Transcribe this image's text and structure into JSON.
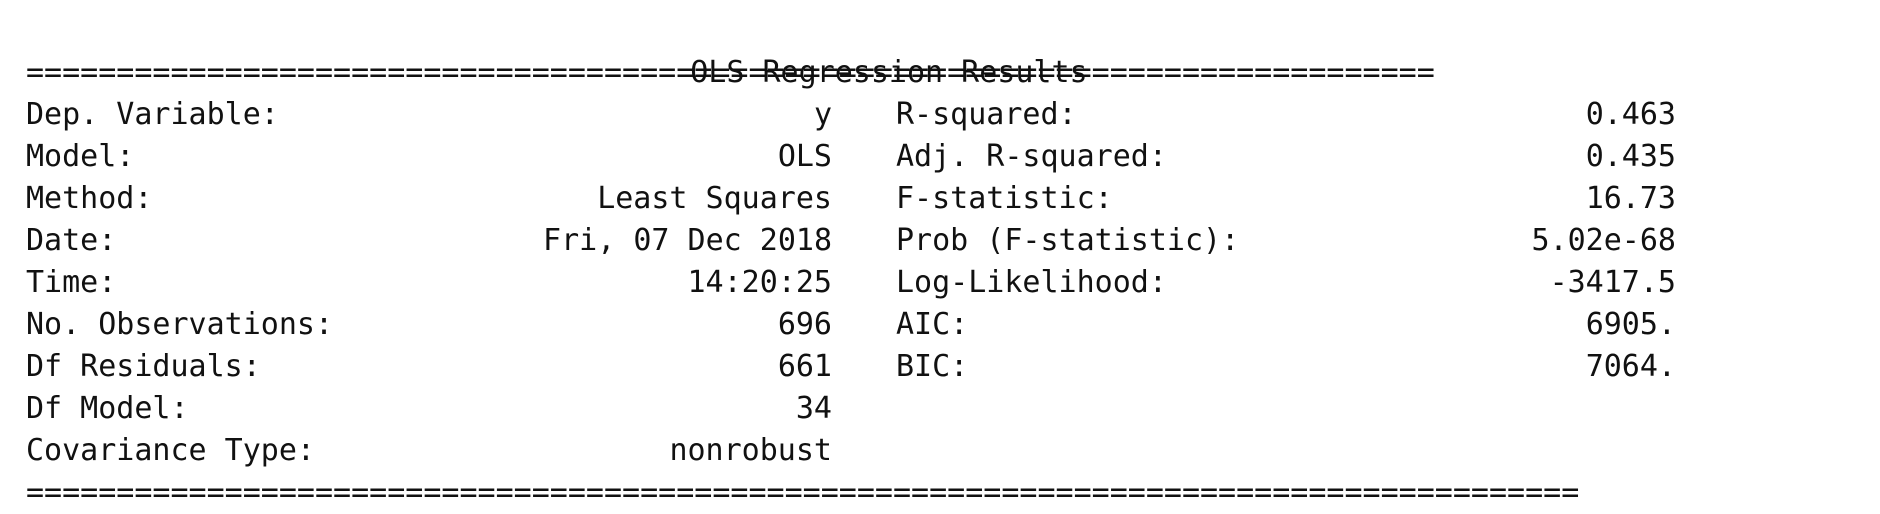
{
  "title": "OLS Regression Results",
  "separators": {
    "top": "==============================================================================",
    "bottom": "======================================================================================"
  },
  "rows": [
    {
      "left_label": "Dep. Variable:",
      "left_value": "y",
      "right_label": "R-squared:",
      "right_value": "0.463"
    },
    {
      "left_label": "Model:",
      "left_value": "OLS",
      "right_label": "Adj. R-squared:",
      "right_value": "0.435"
    },
    {
      "left_label": "Method:",
      "left_value": "Least Squares",
      "right_label": "F-statistic:",
      "right_value": "16.73"
    },
    {
      "left_label": "Date:",
      "left_value": "Fri, 07 Dec 2018",
      "right_label": "Prob (F-statistic):",
      "right_value": "5.02e-68"
    },
    {
      "left_label": "Time:",
      "left_value": "14:20:25",
      "right_label": "Log-Likelihood:",
      "right_value": "-3417.5"
    },
    {
      "left_label": "No. Observations:",
      "left_value": "696",
      "right_label": "AIC:",
      "right_value": "6905."
    },
    {
      "left_label": "Df Residuals:",
      "left_value": "661",
      "right_label": "BIC:",
      "right_value": "7064."
    },
    {
      "left_label": "Df Model:",
      "left_value": "34",
      "right_label": "",
      "right_value": ""
    },
    {
      "left_label": "Covariance Type:",
      "left_value": "nonrobust",
      "right_label": "",
      "right_value": ""
    }
  ]
}
